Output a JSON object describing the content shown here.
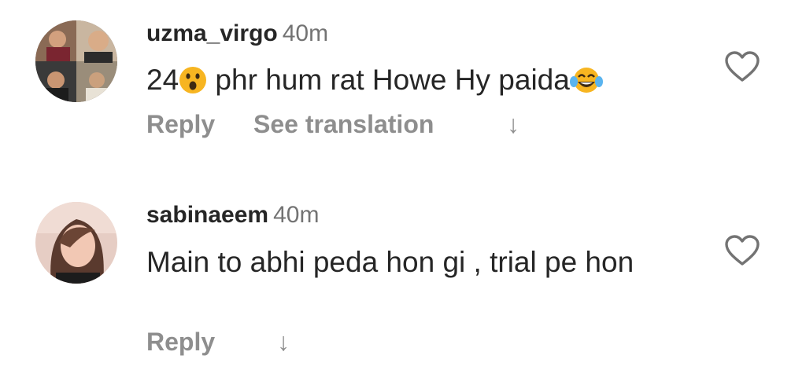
{
  "comments": [
    {
      "username": "uzma_virgo",
      "time": "40m",
      "text_before": "24",
      "emoji_1": "astonished-face",
      "text_after": " phr hum rat Howe Hy paida",
      "emoji_2": "face-with-tears-of-joy",
      "reply_label": "Reply",
      "translate_label": "See translation",
      "arrow": "↓"
    },
    {
      "username": "sabinaeem",
      "time": "40m",
      "text": "Main to abhi peda hon gi , trial pe hon",
      "reply_label": "Reply",
      "arrow": "↓"
    }
  ],
  "colors": {
    "text": "#262626",
    "secondary": "#737373",
    "action": "#8e8e8e",
    "emoji": "#f7b521"
  }
}
